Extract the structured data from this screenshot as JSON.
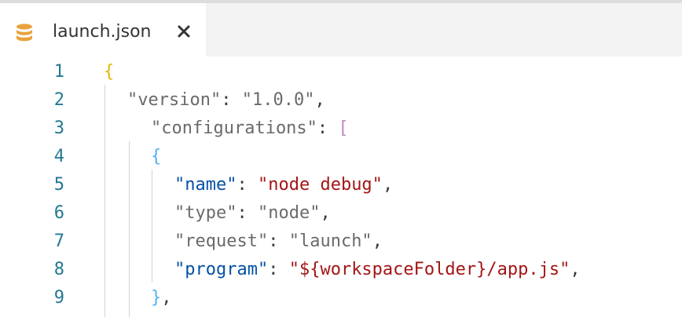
{
  "tab": {
    "title": "launch.json",
    "icon": "database-icon",
    "close_icon": "close-icon",
    "icon_color": "#e8a33d"
  },
  "editor": {
    "line_numbers": [
      "1",
      "2",
      "3",
      "4",
      "5",
      "6",
      "7",
      "8",
      "9"
    ],
    "lines": [
      {
        "tokens": [
          {
            "t": "{",
            "c": "brace1"
          }
        ]
      },
      {
        "tokens": [
          {
            "t": "\"version\"",
            "c": "dim"
          },
          {
            "t": ": ",
            "c": "punct"
          },
          {
            "t": "\"1.0.0\"",
            "c": "dim"
          },
          {
            "t": ",",
            "c": "punct"
          }
        ]
      },
      {
        "tokens": [
          {
            "t": "\"configurations\"",
            "c": "dim"
          },
          {
            "t": ": ",
            "c": "punct"
          },
          {
            "t": "[",
            "c": "bracket2"
          }
        ]
      },
      {
        "tokens": [
          {
            "t": "{",
            "c": "brace3"
          }
        ]
      },
      {
        "tokens": [
          {
            "t": "\"name\"",
            "c": "key-b"
          },
          {
            "t": ": ",
            "c": "punct"
          },
          {
            "t": "\"node debug\"",
            "c": "str-b"
          },
          {
            "t": ",",
            "c": "punct"
          }
        ]
      },
      {
        "tokens": [
          {
            "t": "\"type\"",
            "c": "dim"
          },
          {
            "t": ": ",
            "c": "punct"
          },
          {
            "t": "\"node\"",
            "c": "dim"
          },
          {
            "t": ",",
            "c": "punct"
          }
        ]
      },
      {
        "tokens": [
          {
            "t": "\"request\"",
            "c": "dim"
          },
          {
            "t": ": ",
            "c": "punct"
          },
          {
            "t": "\"launch\"",
            "c": "dim"
          },
          {
            "t": ",",
            "c": "punct"
          }
        ]
      },
      {
        "tokens": [
          {
            "t": "\"program\"",
            "c": "key-b"
          },
          {
            "t": ": ",
            "c": "punct"
          },
          {
            "t": "\"${workspaceFolder}/app.js\"",
            "c": "str-b"
          },
          {
            "t": ",",
            "c": "punct"
          }
        ]
      },
      {
        "tokens": [
          {
            "t": "}",
            "c": "brace3"
          },
          {
            "t": ",",
            "c": "punct"
          }
        ]
      }
    ]
  },
  "colors": {
    "line_number": "#237893",
    "key_blue": "#0451a5",
    "string_red": "#a31515",
    "brace_gold": "#e6b800",
    "bracket_purple": "#c586c0",
    "brace_blue": "#4fb4f0"
  }
}
